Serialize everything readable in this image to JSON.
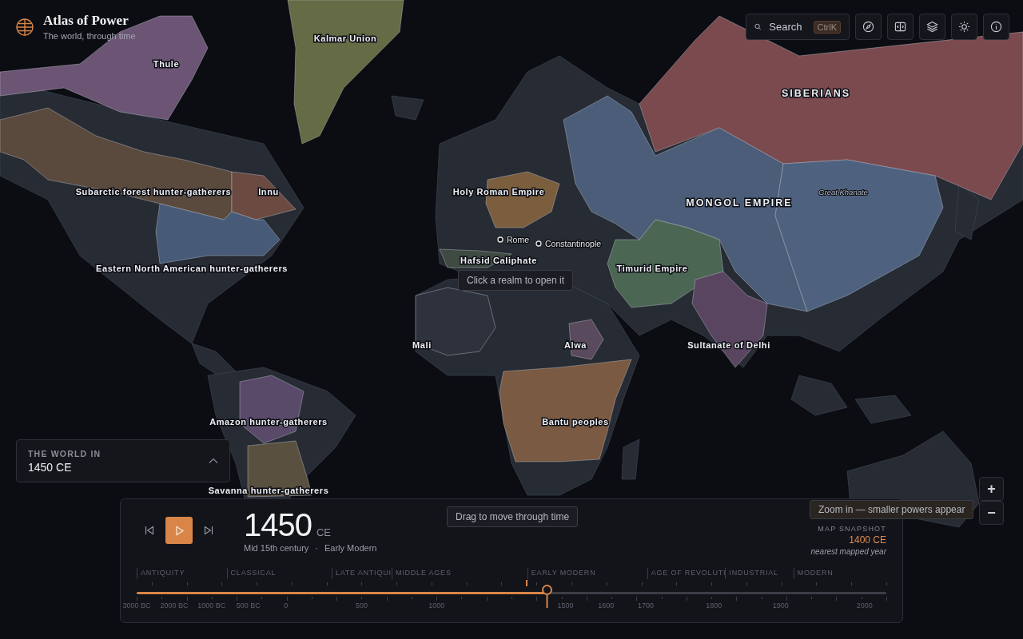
{
  "app": {
    "title": "Atlas of Power",
    "subtitle": "The world, through time"
  },
  "toolbar": {
    "search": {
      "label": "Search",
      "shortcut": "CtrlK"
    },
    "buttons": [
      {
        "kind": "compass"
      },
      {
        "kind": "split"
      },
      {
        "kind": "layers"
      },
      {
        "kind": "theme"
      },
      {
        "kind": "info"
      }
    ]
  },
  "map": {
    "realms": [
      {
        "name": "Kalmar Union",
        "color": "#646b45",
        "kind": "realm"
      },
      {
        "name": "Thule",
        "color": "#6b5474",
        "kind": "realm"
      },
      {
        "name": "SIBERIANS",
        "color": "#7a4a4f",
        "kind": "empire"
      },
      {
        "name": "Subarctic forest hunter-gatherers",
        "color": "#5a4a3e",
        "kind": "realm"
      },
      {
        "name": "Innu",
        "color": "#6b4a42",
        "kind": "realm"
      },
      {
        "name": "Holy Roman Empire",
        "color": "#7a5e3e",
        "kind": "realm"
      },
      {
        "name": "MONGOL EMPIRE",
        "color": "#4b5d78",
        "kind": "empire"
      },
      {
        "name": "Great Khanate",
        "color": "#4e6280",
        "kind": "subrealm"
      },
      {
        "name": "Eastern North American hunter-gatherers",
        "color": "#475a78",
        "kind": "realm"
      },
      {
        "name": "Hafsid Caliphate",
        "color": "#3e4a42",
        "kind": "realm"
      },
      {
        "name": "Timurid Empire",
        "color": "#4c6654",
        "kind": "realm"
      },
      {
        "name": "Mali",
        "color": "#2e323c",
        "kind": "realm"
      },
      {
        "name": "Alwa",
        "color": "#5a4a5e",
        "kind": "realm"
      },
      {
        "name": "Sultanate of Delhi",
        "color": "#5a4560",
        "kind": "realm"
      },
      {
        "name": "Amazon hunter-gatherers",
        "color": "#5a4a6a",
        "kind": "realm"
      },
      {
        "name": "Bantu peoples",
        "color": "#7a5a42",
        "kind": "realm"
      },
      {
        "name": "Savanna hunter-gatherers",
        "color": "#595040",
        "kind": "realm"
      }
    ],
    "cities": [
      {
        "name": "Rome"
      },
      {
        "name": "Constantinople"
      }
    ],
    "hint": "Click a realm to open it"
  },
  "world_in": {
    "label": "THE WORLD IN",
    "value": "1450 CE",
    "expanded": false
  },
  "timeline": {
    "year": "1450",
    "suffix": "CE",
    "description": "Mid 15th century",
    "separator": "·",
    "era": "Early Modern",
    "hint": "Drag to move through time",
    "playing": false,
    "level": 0.547,
    "snapshot": {
      "label": "MAP SNAPSHOT",
      "year": "1400 CE",
      "note": "nearest mapped year",
      "level": 0.52
    },
    "eras": [
      "ANTIQUITY",
      "CLASSICAL",
      "LATE ANTIQUI",
      "MIDDLE AGES",
      "EARLY MODERN",
      "AGE OF REVOLUTI",
      "INDUSTRIAL",
      "MODERN"
    ],
    "ticks": [
      "3000 BC",
      "2000 BC",
      "1000 BC",
      "500 BC",
      "0",
      "500",
      "1000",
      "1500",
      "1600",
      "1700",
      "1800",
      "1900",
      "2000"
    ]
  },
  "zoom": {
    "zoom_in": "+",
    "zoom_out": "−",
    "hint": "Zoom in — smaller powers appear"
  }
}
